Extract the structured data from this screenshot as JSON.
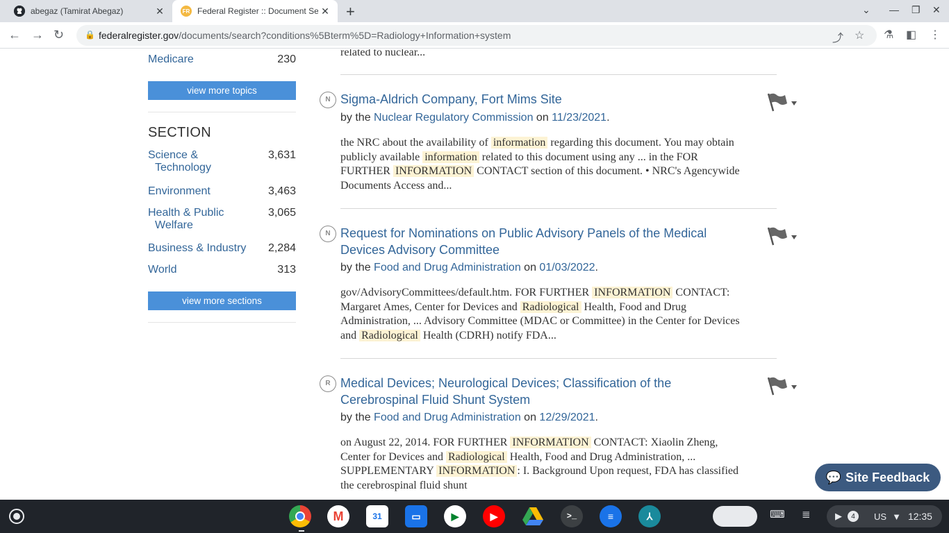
{
  "browser": {
    "tabs": [
      {
        "title": "abegaz (Tamirat Abegaz)",
        "icon": "github-icon"
      },
      {
        "title": "Federal Register :: Document Search",
        "icon": "federal-register-icon",
        "active": true
      }
    ],
    "new_tab": "+",
    "url_host": "federalregister.gov",
    "url_path": "/documents/search?conditions%5Bterm%5D=Radiology+Information+system"
  },
  "sidebar": {
    "topics_tail": {
      "name": "Medicare",
      "count": "230"
    },
    "view_more_topics": "view more topics",
    "section_heading": "SECTION",
    "sections": [
      {
        "line1": "Science &",
        "line2": "Technology",
        "count": "3,631"
      },
      {
        "line1": "Environment",
        "line2": "",
        "count": "3,463"
      },
      {
        "line1": "Health & Public",
        "line2": "Welfare",
        "count": "3,065"
      },
      {
        "line1": "Business & Industry",
        "line2": "",
        "count": "2,284"
      },
      {
        "line1": "World",
        "line2": "",
        "count": "313"
      }
    ],
    "view_more_sections": "view more sections"
  },
  "results": {
    "prev_tail": "related to nuclear...",
    "documents": [
      {
        "badge": "N",
        "title_line1": "Sigma-Aldrich Company, Fort Mims Site",
        "title_line2": "",
        "by": "by the",
        "agency": "Nuclear Regulatory Commission",
        "on": "on",
        "date": "11/23/2021",
        "period": ".",
        "snippet": [
          [
            "the NRC about the availability of ",
            {
              "hl": "information"
            },
            " regarding this document. You may obtain"
          ],
          [
            "publicly available ",
            {
              "hl": "information"
            },
            " related to this document using any ... in the FOR"
          ],
          [
            "FURTHER ",
            {
              "hl": "INFORMATION"
            },
            " CONTACT section of this document. • NRC's Agencywide"
          ],
          [
            "Documents Access and..."
          ]
        ]
      },
      {
        "badge": "N",
        "title_line1": "Request for Nominations on Public Advisory Panels of the Medical",
        "title_line2": "Devices Advisory Committee",
        "by": "by the",
        "agency": "Food and Drug Administration",
        "on": "on",
        "date": "01/03/2022",
        "period": ".",
        "snippet": [
          [
            "gov/AdvisoryCommittees/default.htm. FOR FURTHER ",
            {
              "hl": "INFORMATION"
            },
            " CONTACT:"
          ],
          [
            "Margaret Ames, Center for Devices and ",
            {
              "hl": "Radiological"
            },
            " Health, Food and Drug"
          ],
          [
            "Administration, ... Advisory Committee (MDAC or Committee) in the Center for Devices"
          ],
          [
            "and ",
            {
              "hl": "Radiological"
            },
            " Health (CDRH) notify FDA..."
          ]
        ]
      },
      {
        "badge": "R",
        "title_line1": "Medical Devices; Neurological Devices; Classification of the",
        "title_line2": "Cerebrospinal Fluid Shunt System",
        "by": "by the",
        "agency": "Food and Drug Administration",
        "on": "on",
        "date": "12/29/2021",
        "period": ".",
        "snippet": [
          [
            "on August 22, 2014. FOR FURTHER ",
            {
              "hl": "INFORMATION"
            },
            " CONTACT: Xiaolin Zheng,"
          ],
          [
            "Center for Devices and ",
            {
              "hl": "Radiological"
            },
            " Health, Food and Drug Administration, ..."
          ],
          [
            "SUPPLEMENTARY ",
            {
              "hl": "INFORMATION"
            },
            ": I. Background Upon request, FDA has classified"
          ],
          [
            "the cerebrospinal fluid shunt"
          ]
        ]
      }
    ]
  },
  "feedback_label": "Site Feedback",
  "shelf": {
    "apps": [
      "chrome-icon",
      "gmail-icon",
      "calendar-icon",
      "files-icon",
      "meet-icon",
      "youtube-icon",
      "drive-icon",
      "terminal-icon",
      "messages-icon",
      "acrobat-icon"
    ],
    "calendar_day": "31",
    "notification_count": "4",
    "keyboard_layout": "US",
    "time": "12:35"
  },
  "colors": {
    "link": "#336699",
    "button": "#4a90d9",
    "highlight": "#fdf3d4",
    "feedback": "#3c5a80"
  }
}
